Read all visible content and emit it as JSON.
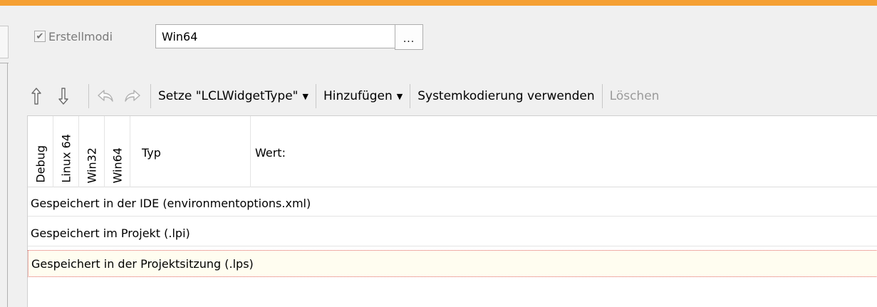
{
  "build_modes": {
    "checkbox_label": "Erstellmodi",
    "checked": true,
    "selected_mode": "Win64",
    "more_button_label": "..."
  },
  "toolbar": {
    "move_up_icon": "arrow-up-icon",
    "move_down_icon": "arrow-down-icon",
    "undo_icon": "undo-icon",
    "redo_icon": "redo-icon",
    "set_widget_type": "Setze \"LCLWidgetType\"",
    "add": "Hinzufügen",
    "system_encoding": "Systemkodierung verwenden",
    "delete": "Löschen"
  },
  "grid": {
    "columns": [
      "Debug",
      "Linux 64",
      "Win32",
      "Win64",
      "Typ",
      "Wert:"
    ],
    "rows": [
      {
        "label": "Gespeichert in der IDE (environmentoptions.xml)"
      },
      {
        "label": "Gespeichert im Projekt (.lpi)"
      },
      {
        "label": "Gespeichert in der Projektsitzung (.lps)"
      }
    ]
  },
  "colors": {
    "accent": "#f5a033",
    "selection_border": "#e06060"
  }
}
